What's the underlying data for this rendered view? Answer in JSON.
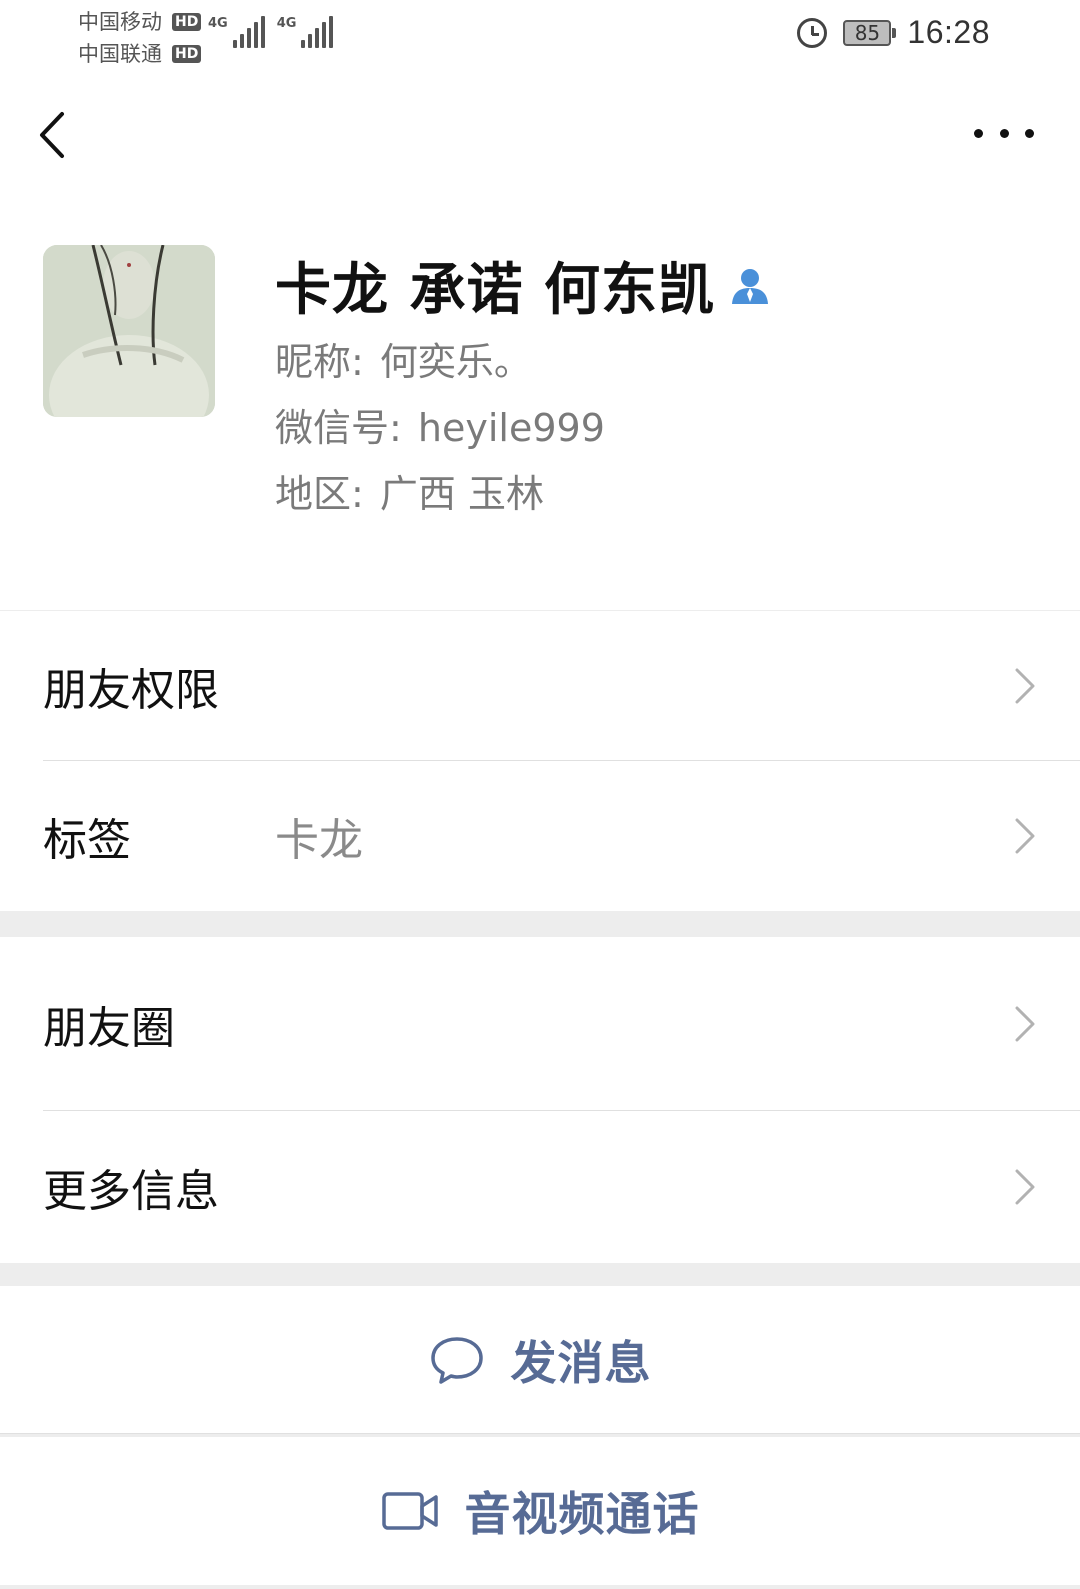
{
  "status_bar": {
    "carrier_1": "中国移动",
    "carrier_2": "中国联通",
    "hd_label": "HD",
    "network_1": "4G",
    "network_2": "4G",
    "battery_level": "85",
    "time": "16:28"
  },
  "nav": {
    "back_icon": "chevron-left-icon",
    "more_icon": "more-dots-icon"
  },
  "profile": {
    "display_name": "卡龙 承诺 何东凯",
    "nickname_label": "昵称: ",
    "nickname_value": "何奕乐。",
    "wechat_id_label": "微信号: ",
    "wechat_id_value": "heyile999",
    "region_label": "地区: ",
    "region_value": "广西  玉林"
  },
  "section_1": {
    "friend_permissions_label": "朋友权限",
    "tags_label": "标签",
    "tags_value": "卡龙"
  },
  "section_2": {
    "moments_label": "朋友圈",
    "more_info_label": "更多信息"
  },
  "actions": {
    "send_message_label": "发消息",
    "video_call_label": "音视频通话"
  },
  "colors": {
    "accent_link": "#576b95",
    "contact_icon": "#4a90d9",
    "background": "#ededed"
  }
}
